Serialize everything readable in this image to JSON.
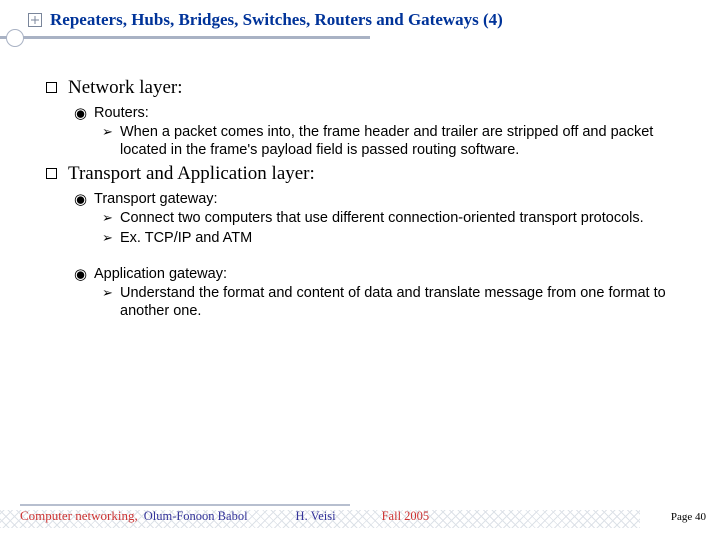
{
  "title": "Repeaters, Hubs, Bridges, Switches, Routers and Gateways (4)",
  "sections": [
    {
      "heading": "Network layer:",
      "items": [
        {
          "label": "Routers:",
          "points": [
            "When a packet comes into, the frame header and trailer are stripped off and packet located in the frame's payload field is passed routing software."
          ]
        }
      ]
    },
    {
      "heading": "Transport and Application layer:",
      "items": [
        {
          "label": "Transport gateway:",
          "points": [
            "Connect two computers that use different connection-oriented transport protocols.",
            "Ex. TCP/IP and ATM"
          ]
        },
        {
          "label": "Application gateway:",
          "points": [
            "Understand the format and content of data and translate message from one format to another one."
          ]
        }
      ]
    }
  ],
  "footer": {
    "course": "Computer networking,",
    "institution": "Olum-Fonoon Babol",
    "author": "H. Veisi",
    "term": "Fall 2005",
    "page": "Page 40"
  }
}
